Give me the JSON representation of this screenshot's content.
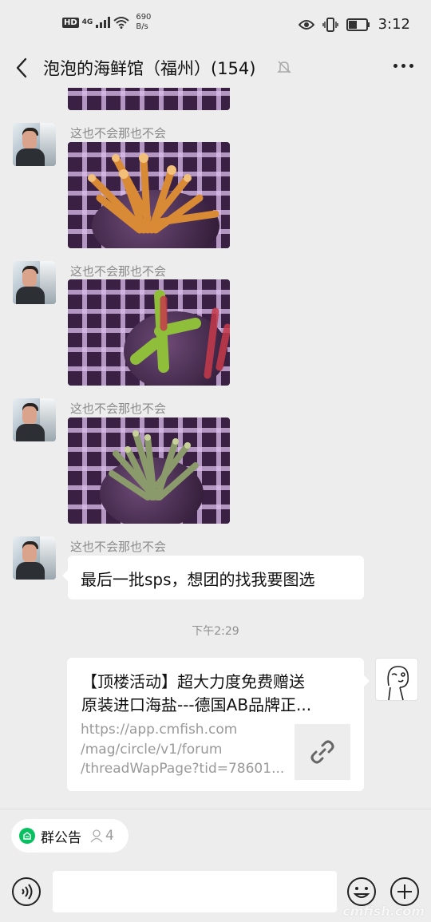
{
  "status_bar": {
    "hd": "HD",
    "network_type": "4G",
    "speed_value": "690",
    "speed_unit": "B/s",
    "time": "3:12"
  },
  "header": {
    "title": "泡泡的海鲜馆（福州）(154)"
  },
  "messages": [
    {
      "type": "image",
      "sender": "这也不会那也不会"
    },
    {
      "type": "image",
      "sender": "这也不会那也不会"
    },
    {
      "type": "image",
      "sender": "这也不会那也不会"
    },
    {
      "type": "text",
      "sender": "这也不会那也不会",
      "text": "最后一批sps，想团的找我要图选"
    }
  ],
  "timestamp": "下午2:29",
  "link_card": {
    "title_line1": "【顶楼活动】超大力度免费赠送",
    "title_line2": "原装进口海盐---德国AB品牌正...",
    "url_line1": "https://app.cmfish.com",
    "url_line2": "/mag/circle/v1/forum",
    "url_line3": "/threadWapPage?tid=78601..."
  },
  "announcement": {
    "label": "群公告",
    "count": "4"
  },
  "input": {
    "placeholder": ""
  },
  "watermark": "cmfish.com",
  "icons": {
    "back": "chevron-left-icon",
    "mute": "bell-muted-icon",
    "more": "more-dots-icon",
    "link": "link-icon",
    "voice": "voice-icon",
    "emoji": "emoji-icon",
    "plus": "plus-icon"
  },
  "colors": {
    "background": "#ededed",
    "bubble": "#ffffff",
    "accent_green": "#07c160"
  }
}
